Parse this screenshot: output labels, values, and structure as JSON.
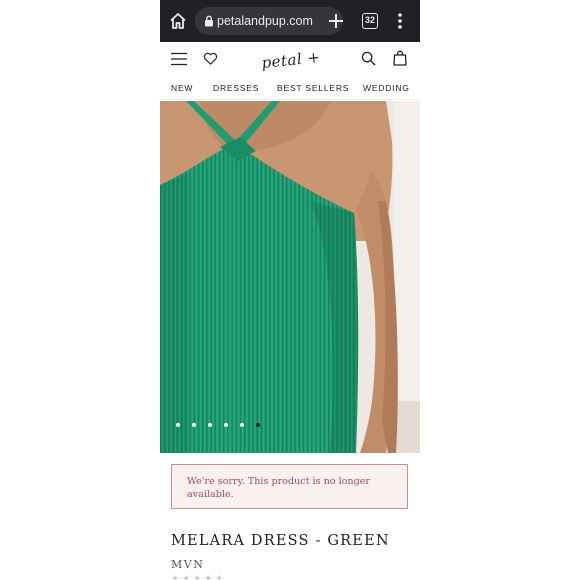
{
  "browser": {
    "url_text": "petalandpup.com",
    "tab_count": "32",
    "home_icon": "home-icon",
    "lock_icon": "lock-icon",
    "new_tab_icon": "plus-icon",
    "menu_icon": "kebab-menu-icon",
    "bar_color": "#202124"
  },
  "site": {
    "logo_text": "petal + pup",
    "icons": [
      "hamburger-menu-icon",
      "heart-icon",
      "search-icon",
      "shopping-bag-icon"
    ]
  },
  "nav": {
    "items": [
      "NEW",
      "DRESSES",
      "BEST SELLERS",
      "WEDDING"
    ]
  },
  "gallery": {
    "image_count": 6,
    "active_index": 5,
    "dress_color": "#1f9d72"
  },
  "notice": {
    "text": "We're sorry. This product is no longer available.",
    "border_color": "#c98f92"
  },
  "product": {
    "title": "MELARA DRESS - GREEN",
    "brand": "MVN"
  }
}
